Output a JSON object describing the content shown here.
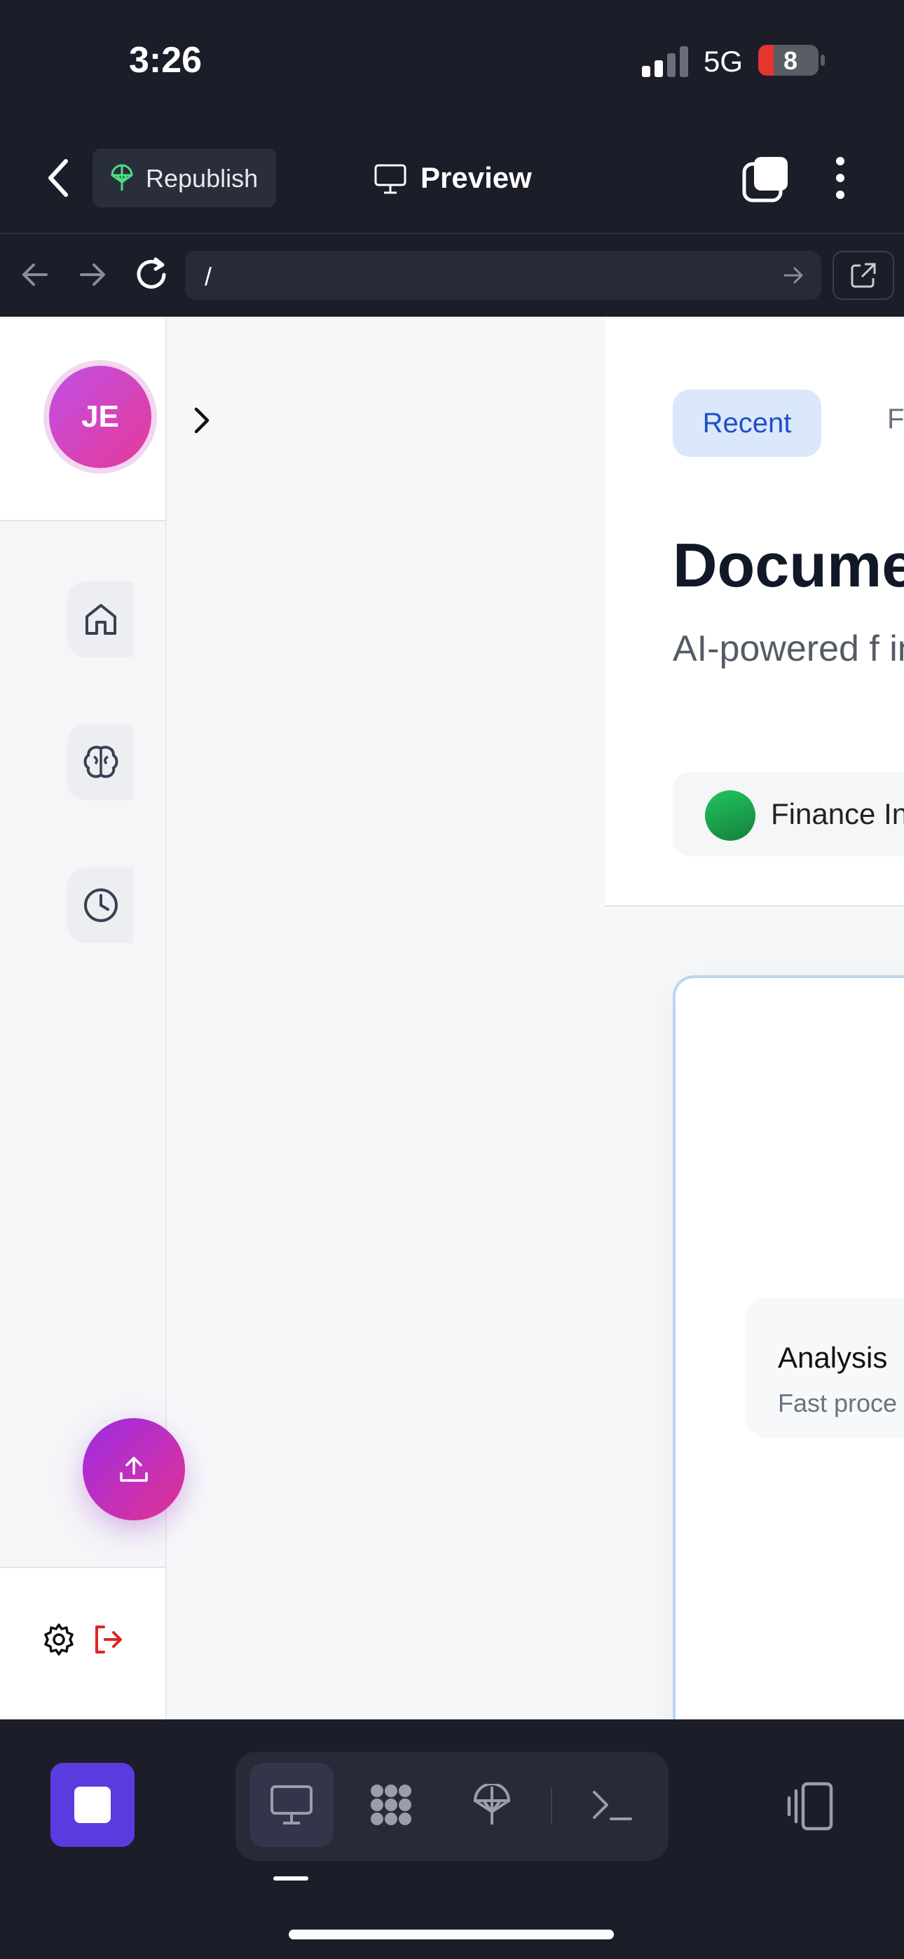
{
  "status_bar": {
    "time": "3:26",
    "network": "5G",
    "battery": "8"
  },
  "app_bar": {
    "republish_label": "Republish",
    "preview_label": "Preview"
  },
  "browser": {
    "url": "/"
  },
  "sidebar": {
    "avatar_initials": "JE",
    "items": [
      "home-icon",
      "brain-icon",
      "clock-icon"
    ]
  },
  "main": {
    "tabs": [
      {
        "label": "Recent",
        "active": true
      },
      {
        "label": "F"
      }
    ],
    "title": "Docume",
    "subtitle": "AI-powered f intelligence",
    "chip_label": "Finance In",
    "card": {
      "title": "Analysis",
      "subtitle": "Fast proce"
    }
  },
  "colors": {
    "accent": "#5a3be0",
    "avatar_gradient": [
      "#c24fe6",
      "#e43a97"
    ],
    "tab_active_bg": "#dbe8fb",
    "tab_active_text": "#1e50c8"
  },
  "toolbar": {
    "tools": [
      "desktop-icon",
      "grid-icon",
      "publish-icon",
      "terminal-icon"
    ]
  }
}
